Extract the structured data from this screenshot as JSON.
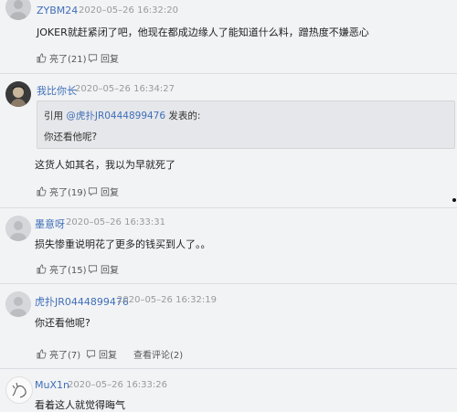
{
  "comments": [
    {
      "username": "ZYBM24",
      "time": "2020–05–26 16:32:20",
      "text": "JOKER就赶紧闭了吧，他现在都成边缘人了能知道什么料，蹭热度不嫌恶心",
      "like_label": "亮了(21)",
      "reply_label": "回复"
    },
    {
      "username": "我比你长",
      "time": "2020–05–26 16:34:27",
      "quote": {
        "prefix": "引用 ",
        "link": "@虎扑JR0444899476",
        "suffix": " 发表的:",
        "text": "你还看他呢?"
      },
      "text": "这货人如其名，我以为早就死了",
      "like_label": "亮了(19)",
      "reply_label": "回复"
    },
    {
      "username": "墨意呀",
      "time": "2020–05–26 16:33:31",
      "text": "损失惨重说明花了更多的钱买到人了。。",
      "like_label": "亮了(15)",
      "reply_label": "回复"
    },
    {
      "username": "虎扑JR0444899476",
      "time": "2020–05–26 16:32:19",
      "text": "你还看他呢?",
      "like_label": "亮了(7)",
      "reply_label": "回复",
      "view_label": "查看评论(2)"
    },
    {
      "username": "MuX1n",
      "time": "2020–05–26 16:33:26",
      "text": "看着这人就觉得晦气"
    }
  ],
  "colors": {
    "link": "#3f6fb8",
    "background": "#f2f3f5",
    "quote_bg": "#e6e7ea"
  },
  "icons": {
    "like": "thumbs-up-icon",
    "reply": "reply-icon",
    "view": "comment-icon"
  }
}
